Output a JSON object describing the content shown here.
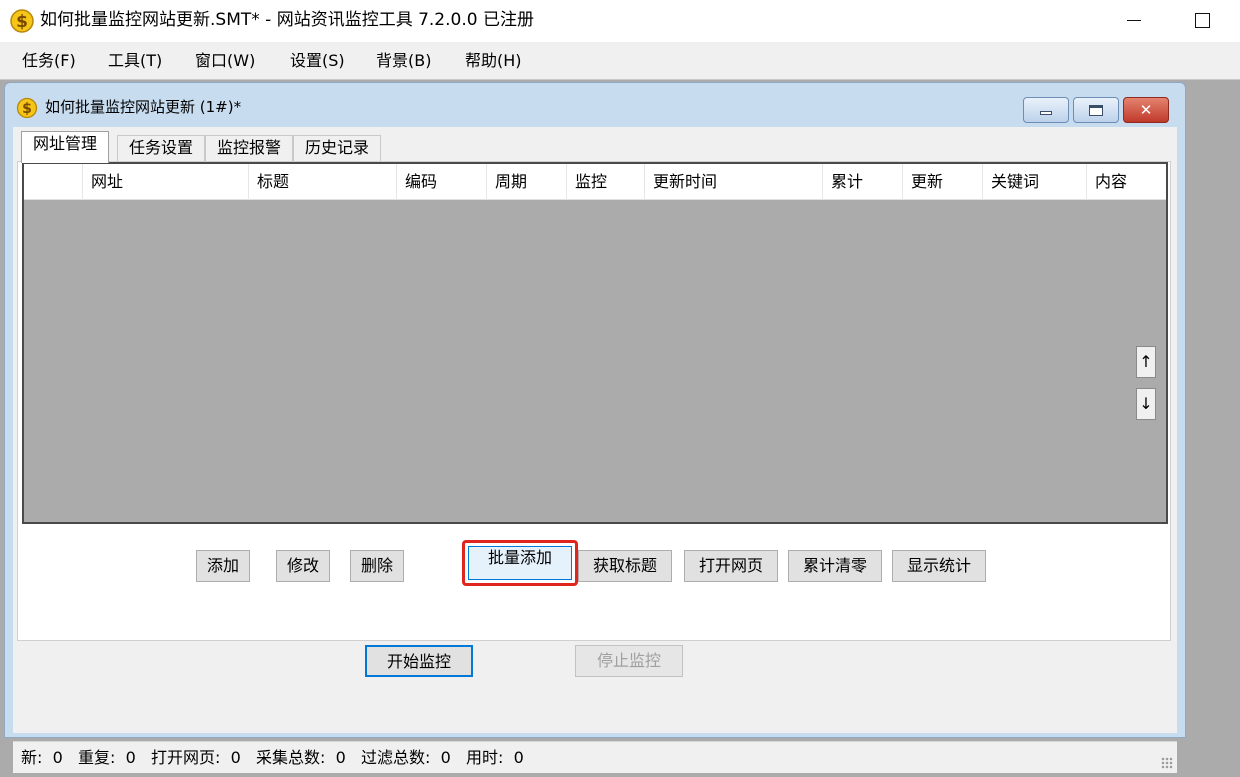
{
  "app": {
    "title": "如何批量监控网站更新.SMT* - 网站资讯监控工具 7.2.0.0  已注册",
    "icon": "dollar-coin-icon"
  },
  "window_controls": {
    "minimize_icon": "minimize-icon",
    "maximize_icon": "maximize-icon"
  },
  "menu": {
    "items": [
      {
        "label": "任务(F)"
      },
      {
        "label": "工具(T)"
      },
      {
        "label": "窗口(W)"
      },
      {
        "label": "设置(S)"
      },
      {
        "label": "背景(B)"
      },
      {
        "label": "帮助(H)"
      }
    ]
  },
  "child_window": {
    "title": "如何批量监控网站更新  (1#)*",
    "icon": "dollar-coin-icon"
  },
  "tabs": [
    {
      "label": "网址管理",
      "active": true
    },
    {
      "label": "任务设置",
      "active": false
    },
    {
      "label": "监控报警",
      "active": false
    },
    {
      "label": "历史记录",
      "active": false
    }
  ],
  "table": {
    "columns": [
      "",
      "网址",
      "标题",
      "编码",
      "周期",
      "监控",
      "更新时间",
      "累计",
      "更新",
      "关键词",
      "内容"
    ],
    "rows": []
  },
  "scroll": {
    "up_glyph": "↑",
    "down_glyph": "↓"
  },
  "buttons": {
    "add": "添加",
    "edit": "修改",
    "delete": "删除",
    "batch_add": "批量添加",
    "fetch_title": "获取标题",
    "open_page": "打开网页",
    "reset_count": "累计清零",
    "show_stats": "显示统计",
    "start": "开始监控",
    "stop": "停止监控"
  },
  "status": "新:  0   重复:  0   打开网页:  0   采集总数:  0   过滤总数:  0   用时:  0",
  "colors": {
    "highlight": "#e0241e",
    "accent": "#0078d7",
    "background": "#ababab"
  }
}
